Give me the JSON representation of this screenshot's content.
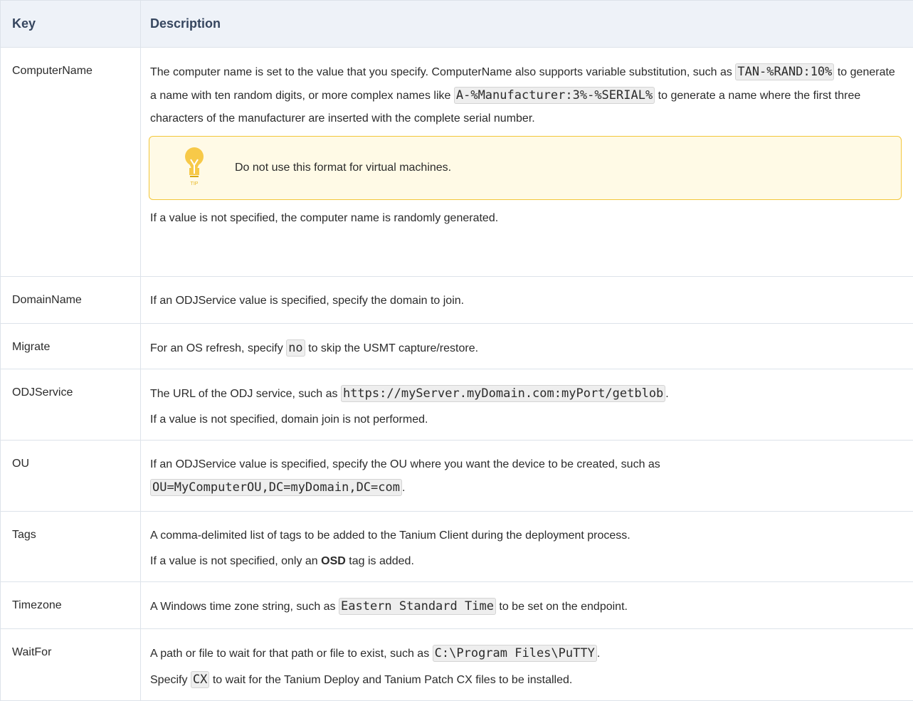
{
  "headers": {
    "key": "Key",
    "description": "Description"
  },
  "rows": {
    "computername": {
      "key": "ComputerName",
      "t1": "The computer name is set to the value that you specify. ComputerName also supports variable substitution, such as ",
      "c1": "TAN-%RAND:10%",
      "t2": " to generate a name with ten random digits, or more complex names like ",
      "c2": "A-%Manufacturer:3%-%SERIAL%",
      "t3": " to generate a name where the first three characters of the manufacturer are inserted with the complete serial number.",
      "tip_text": "Do not use this format for virtual machines.",
      "tip_label": "TIP",
      "after": "If a value is not specified, the computer name is randomly generated."
    },
    "domainname": {
      "key": "DomainName",
      "text": "If an ODJService value is specified, specify the domain to join."
    },
    "migrate": {
      "key": "Migrate",
      "t1": "For an OS refresh, specify ",
      "c1": "no",
      "t2": " to skip the USMT capture/restore."
    },
    "odjservice": {
      "key": "ODJService",
      "t1": "The URL of the ODJ service, such as ",
      "c1": "https://myServer.myDomain.com:myPort/getblob",
      "t2": ".",
      "p2": "If a value is not specified, domain join is not performed."
    },
    "ou": {
      "key": "OU",
      "t1": "If an ODJService value is specified, specify the OU where you want the device to be created, such as ",
      "c1": "OU=MyComputerOU,DC=myDomain,DC=com",
      "t2": "."
    },
    "tags": {
      "key": "Tags",
      "p1": "A comma-delimited list of tags to be added to the Tanium Client during the deployment process.",
      "t1": "If a value is not specified, only an ",
      "bold": "OSD",
      "t2": " tag is added."
    },
    "timezone": {
      "key": "Timezone",
      "t1": "A Windows time zone string, such as ",
      "c1": "Eastern Standard Time",
      "t2": " to be set on the endpoint."
    },
    "waitfor": {
      "key": "WaitFor",
      "t1": "A path or file to wait for that path or file to exist, such as ",
      "c1": "C:\\Program Files\\PuTTY",
      "t2": ".",
      "t3": "Specify ",
      "c2": "CX",
      "t4": " to wait for the Tanium Deploy and Tanium Patch CX files to be installed."
    }
  },
  "colors": {
    "header_bg": "#eef2f8",
    "header_text": "#36465f",
    "tip_border": "#f3c73b",
    "tip_bg": "#fffae6",
    "bulb": "#f7c948"
  },
  "icons": {
    "tip": "lightbulb-icon"
  }
}
